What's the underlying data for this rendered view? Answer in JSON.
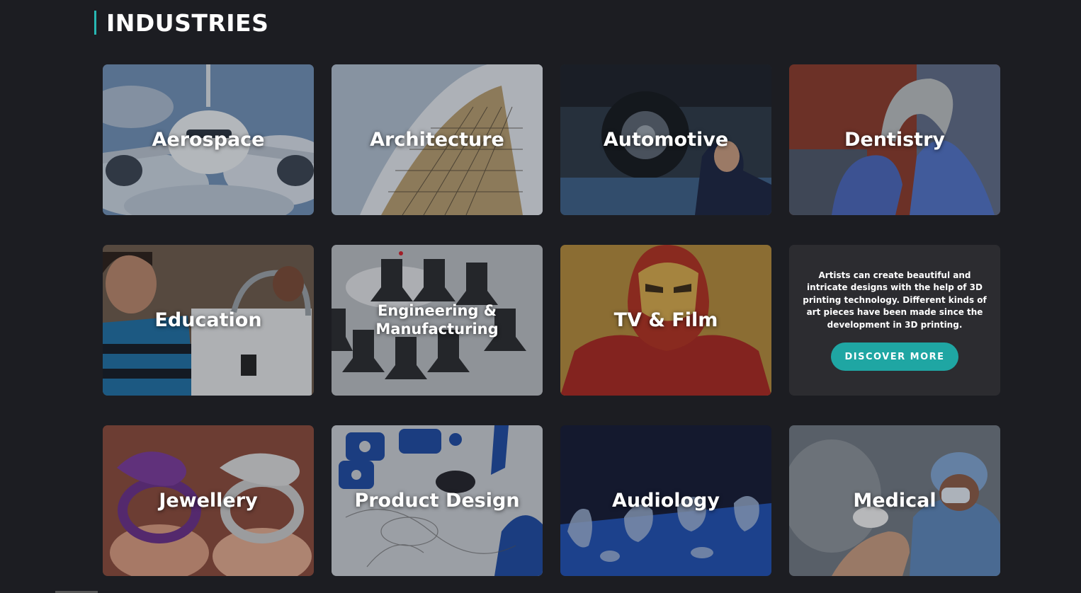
{
  "section": {
    "title": "INDUSTRIES",
    "accent_color": "#27b7b3"
  },
  "cards": [
    {
      "label": "Aerospace"
    },
    {
      "label": "Architecture"
    },
    {
      "label": "Automotive"
    },
    {
      "label": "Dentistry"
    },
    {
      "label": "Education"
    },
    {
      "label": "Engineering & Manufacturing"
    },
    {
      "label": "TV & Film"
    },
    {
      "label": "Jewellery"
    },
    {
      "label": "Product Design"
    },
    {
      "label": "Audiology"
    },
    {
      "label": "Medical"
    }
  ],
  "info": {
    "text": "Artists can create beautiful and intricate designs with the help of 3D printing technology. Different kinds of art pieces have been made since the development in 3D printing.",
    "button_label": "DISCOVER MORE",
    "button_color": "#1fa6a3"
  }
}
